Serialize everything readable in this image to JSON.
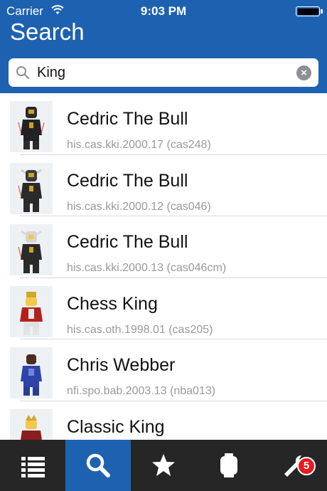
{
  "status_bar": {
    "carrier": "Carrier",
    "time": "9:03 PM"
  },
  "header": {
    "title": "Search"
  },
  "search": {
    "value": "King"
  },
  "results": [
    {
      "title": "Cedric The Bull",
      "subtitle": "his.cas.kki.2000.17 (cas248)"
    },
    {
      "title": "Cedric The Bull",
      "subtitle": "his.cas.kki.2000.12 (cas046)"
    },
    {
      "title": "Cedric The Bull",
      "subtitle": "his.cas.kki.2000.13 (cas046cm)"
    },
    {
      "title": "Chess King",
      "subtitle": "his.cas.oth.1998.01 (cas205)"
    },
    {
      "title": "Chris Webber",
      "subtitle": "nfi.spo.bab.2003.13 (nba013)"
    },
    {
      "title": "Classic King",
      "subtitle": ""
    }
  ],
  "tabbar": {
    "tabs": [
      {
        "icon": "list-icon",
        "active": false
      },
      {
        "icon": "search-icon",
        "active": true
      },
      {
        "icon": "star-icon",
        "active": false
      },
      {
        "icon": "minifig-head-icon",
        "active": false
      },
      {
        "icon": "wrench-icon",
        "active": false,
        "badge": "5"
      }
    ]
  },
  "colors": {
    "accent": "#1d62b0",
    "tabbar": "#262626",
    "badge": "#e31b23"
  }
}
